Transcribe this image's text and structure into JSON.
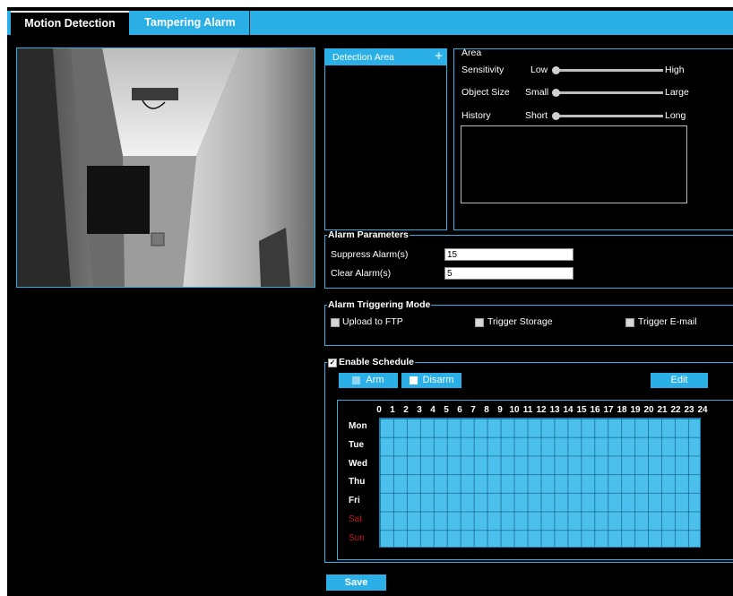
{
  "tabs": [
    {
      "label": "Motion Detection",
      "active": true
    },
    {
      "label": "Tampering Alarm",
      "active": false
    }
  ],
  "detection_area": {
    "label": "Detection Area",
    "add_icon": "plus-icon"
  },
  "area": {
    "title": "Area",
    "sliders": [
      {
        "name": "Sensitivity",
        "min_label": "Low",
        "max_label": "High",
        "value": 0
      },
      {
        "name": "Object Size",
        "min_label": "Small",
        "max_label": "Large",
        "value": 0
      },
      {
        "name": "History",
        "min_label": "Short",
        "max_label": "Long",
        "value": 0
      }
    ]
  },
  "alarm_parameters": {
    "title": "Alarm Parameters",
    "suppress_label": "Suppress Alarm(s)",
    "suppress_value": "15",
    "clear_label": "Clear Alarm(s)",
    "clear_value": "5"
  },
  "triggering": {
    "title": "Alarm Triggering Mode",
    "options": [
      {
        "label": "Upload to FTP",
        "checked": false
      },
      {
        "label": "Trigger Storage",
        "checked": false
      },
      {
        "label": "Trigger E-mail",
        "checked": false
      }
    ]
  },
  "schedule": {
    "enable_label": "Enable Schedule",
    "enabled": true,
    "arm_label": "Arm",
    "disarm_label": "Disarm",
    "edit_label": "Edit",
    "hours": [
      "0",
      "1",
      "2",
      "3",
      "4",
      "5",
      "6",
      "7",
      "8",
      "9",
      "10",
      "11",
      "12",
      "13",
      "14",
      "15",
      "16",
      "17",
      "18",
      "19",
      "20",
      "21",
      "22",
      "23",
      "24"
    ],
    "days": [
      "Mon",
      "Tue",
      "Wed",
      "Thu",
      "Fri",
      "Sat",
      "Sun"
    ],
    "weekend_color": "#c21b1b",
    "grid_color": "#4cc0ec"
  },
  "save_label": "Save",
  "accent_color": "#2ab0e6"
}
